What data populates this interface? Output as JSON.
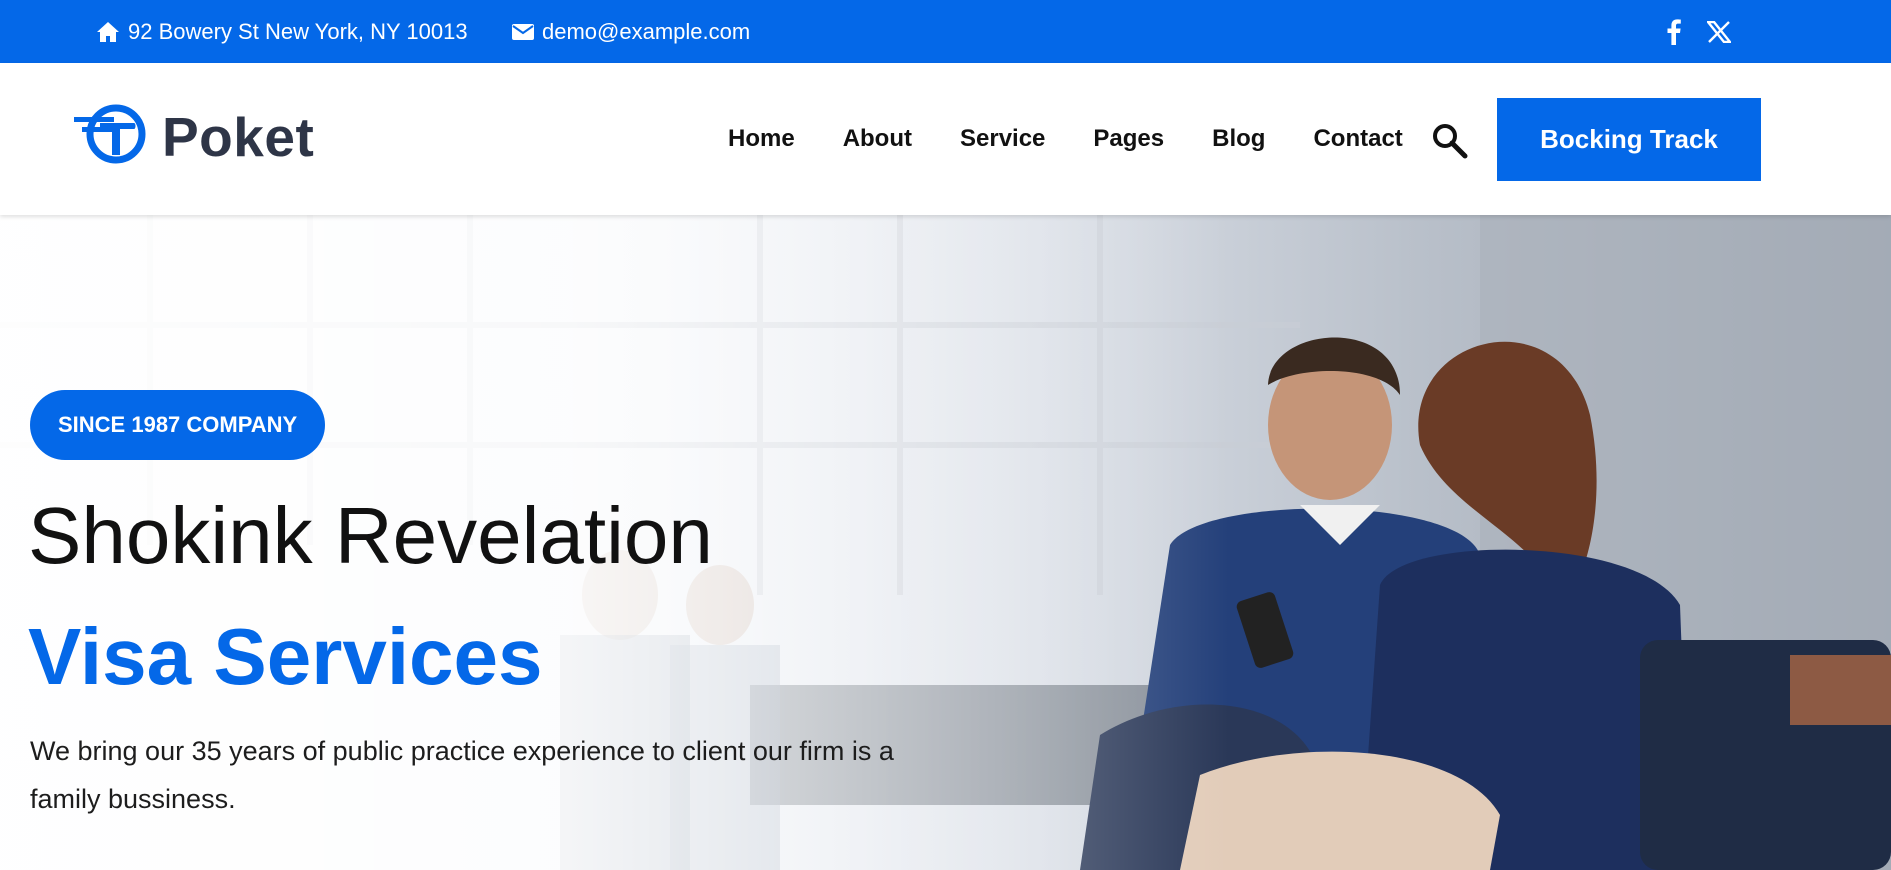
{
  "topbar": {
    "address": "92 Bowery St New York, NY 10013",
    "email": "demo@example.com",
    "socials": [
      {
        "name": "facebook-icon"
      },
      {
        "name": "x-icon"
      }
    ]
  },
  "header": {
    "logo_text": "Poket",
    "nav": [
      "Home",
      "About",
      "Service",
      "Pages",
      "Blog",
      "Contact"
    ],
    "cta_label": "Bocking Track"
  },
  "hero": {
    "badge": "SINCE 1987 COMPANY",
    "title_line1": "Shokink Revelation",
    "title_line2": "Visa Services",
    "description": "We bring our 35 years of public practice experience to client our firm is a family bussiness."
  },
  "colors": {
    "accent": "#0468e8",
    "logo_text": "#2e3547"
  }
}
